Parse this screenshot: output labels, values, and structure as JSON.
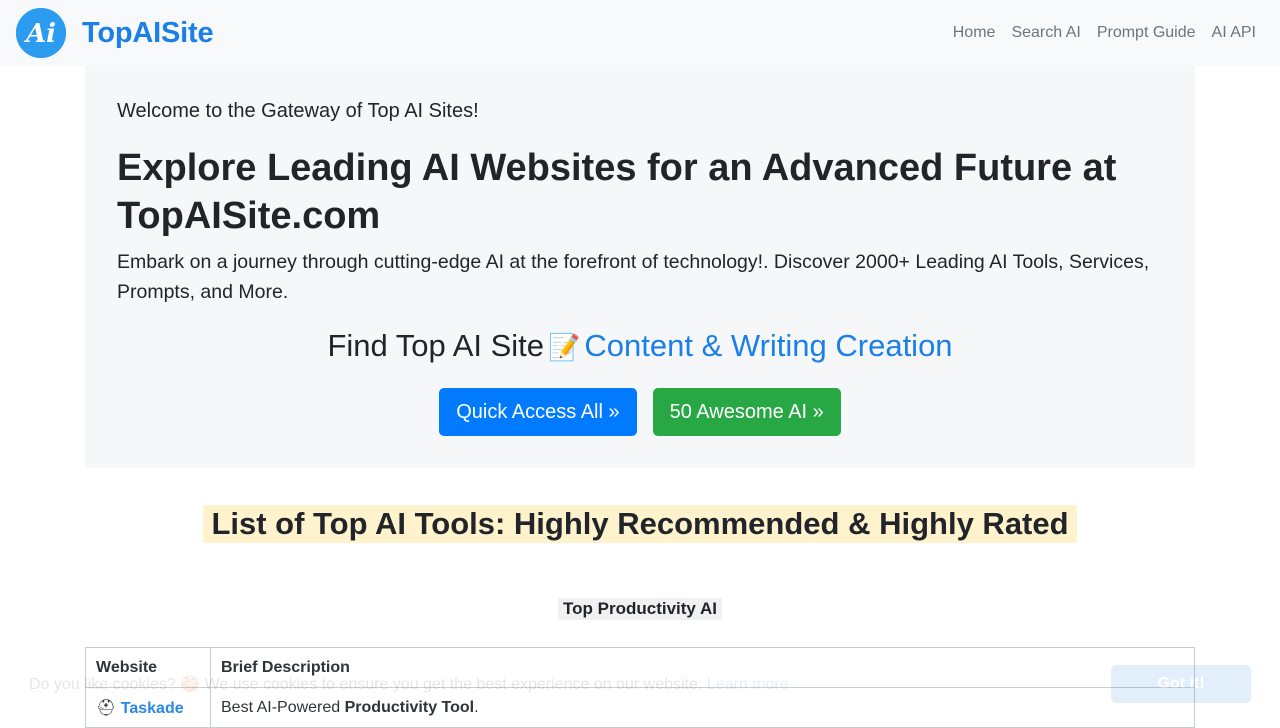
{
  "navbar": {
    "logo_text": "Ai",
    "brand": "TopAISite",
    "links": [
      "Home",
      "Search AI",
      "Prompt Guide",
      "AI API"
    ]
  },
  "hero": {
    "welcome": "Welcome to the Gateway of Top AI Sites!",
    "headline": "Explore Leading AI Websites for an Advanced Future at TopAISite.com",
    "lead": "Embark on a journey through cutting-edge AI at the forefront of technology!. Discover 2000+ Leading AI Tools, Services, Prompts, and More.",
    "find_prefix": "Find Top AI Site",
    "find_emoji": "📝",
    "find_category": "Content & Writing Creation",
    "button_quick": "Quick Access All »",
    "button_awesome": "50 Awesome AI »"
  },
  "section": {
    "title": "List of Top AI Tools: Highly Recommended & Highly Rated",
    "subtitle": "Top Productivity AI"
  },
  "table": {
    "headers": [
      "Website",
      "Brief Description"
    ],
    "rows": [
      {
        "icon": "⛑",
        "name": "Taskade",
        "desc_prefix": "Best AI-Powered ",
        "desc_bold": "Productivity Tool",
        "desc_suffix": "."
      }
    ]
  },
  "cookie": {
    "text": "Do you like cookies? 🍪 We use cookies to ensure you get the best experience on our website.",
    "link": "Learn more",
    "button": "Got it!"
  },
  "colors": {
    "brand": "#1a7fe6",
    "primary_button": "#007bff",
    "success_button": "#28a745",
    "highlight": "#fff3cd"
  }
}
